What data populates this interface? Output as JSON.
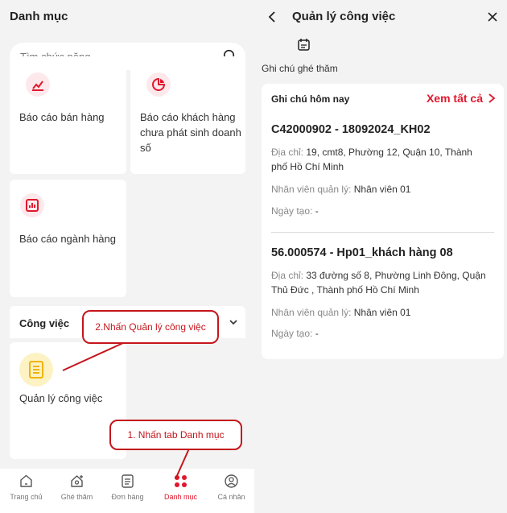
{
  "left": {
    "title": "Danh mục",
    "search_placeholder": "Tìm chức năng",
    "report_items": [
      {
        "label": "Báo cáo bán hàng"
      },
      {
        "label": "Báo cáo khách hàng chưa phát sinh doanh số"
      },
      {
        "label": "Báo cáo ngành hàng"
      }
    ],
    "section_title": "Công việc",
    "task_item_label": "Quản lý công việc",
    "nav": [
      {
        "label": "Trang chủ",
        "icon": "home-icon"
      },
      {
        "label": "Ghé thăm",
        "icon": "visit-icon"
      },
      {
        "label": "Đơn hàng",
        "icon": "order-icon"
      },
      {
        "label": "Danh mục",
        "icon": "grid-icon"
      },
      {
        "label": "Cá nhân",
        "icon": "user-icon"
      }
    ],
    "callout_1": "1. Nhấn tab Danh mục",
    "callout_2": "2.Nhấn Quản lý công việc"
  },
  "right": {
    "title": "Quản lý công việc",
    "tab_label": "Ghi chú ghé thăm",
    "notes_heading": "Ghi chú hôm nay",
    "see_all": "Xem tất cả",
    "entries": [
      {
        "title": "C42000902 - 18092024_KH02",
        "address_label": "Địa chỉ:",
        "address": "19, cmt8, Phường 12, Quận 10, Thành phố Hồ Chí Minh",
        "manager_label": "Nhân viên quản lý:",
        "manager": "Nhân viên 01",
        "created_label": "Ngày tạo:",
        "created": "-"
      },
      {
        "title": "56.000574 - Hp01_khách hàng 08",
        "address_label": "Địa chỉ:",
        "address": "33 đường số 8, Phường Linh Đông, Quận Thủ Đức , Thành phố Hồ Chí Minh",
        "manager_label": "Nhân viên quản lý:",
        "manager": "Nhân viên 01",
        "created_label": "Ngày tạo:",
        "created": "-"
      }
    ]
  },
  "colors": {
    "accent": "#e0182d",
    "callout": "#c4161c",
    "background": "#f3f3f3"
  }
}
